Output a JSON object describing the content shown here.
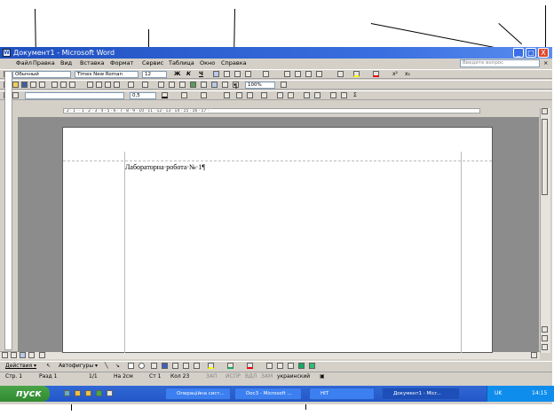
{
  "window": {
    "title": "Документ1 - Microsoft Word",
    "controls": {
      "minimize": "_",
      "maximize": "□",
      "close": "X"
    }
  },
  "menu": {
    "items": [
      "Файл",
      "Правка",
      "Вид",
      "Вставка",
      "Формат",
      "Сервис",
      "Таблица",
      "Окно",
      "Справка"
    ],
    "ask_placeholder": "Введите вопрос",
    "close_doc": "× "
  },
  "formatting": {
    "style": "Обычный",
    "font": "Times New Roman",
    "size": "12",
    "bold": "Ж",
    "italic": "К",
    "underline": "Ч"
  },
  "standard": {
    "zoom": "100%",
    "line_width": "0,5"
  },
  "ruler": {
    "marks": "· 2 · 1 · · 1 · 2 · 3 · 4 · 5 · 6 · 7 · 8 · 9 · 10 · 11 · 12 · 13 · 14 · 15 · 16 · 17 ·"
  },
  "document": {
    "text": "Лабораторна·робота·№·1¶"
  },
  "drawing": {
    "actions": "Действия ▾",
    "autoshapes": "Автофигуры ▾"
  },
  "status": {
    "page": "Стр. 1",
    "section": "Разд 1",
    "pages": "1/1",
    "position": "На 2см",
    "line": "Ст 1",
    "column": "Кол 23",
    "rec": "ЗАП",
    "trk": "ИСПР",
    "ext": "ВДЛ",
    "ovr": "ЗАМ",
    "language": "украинский"
  },
  "taskbar": {
    "start": "пуск",
    "tasks": [
      "Операційна сист...",
      "Doc3 - Microsoft ...",
      "НІТ",
      "Документ1 - Micr..."
    ],
    "lang": "UK",
    "clock": "14:15"
  },
  "colors": {
    "title_bar": "#1f4fbf",
    "taskbar": "#3168d5",
    "start": "#3a9a3a",
    "close": "#e04a2a"
  }
}
